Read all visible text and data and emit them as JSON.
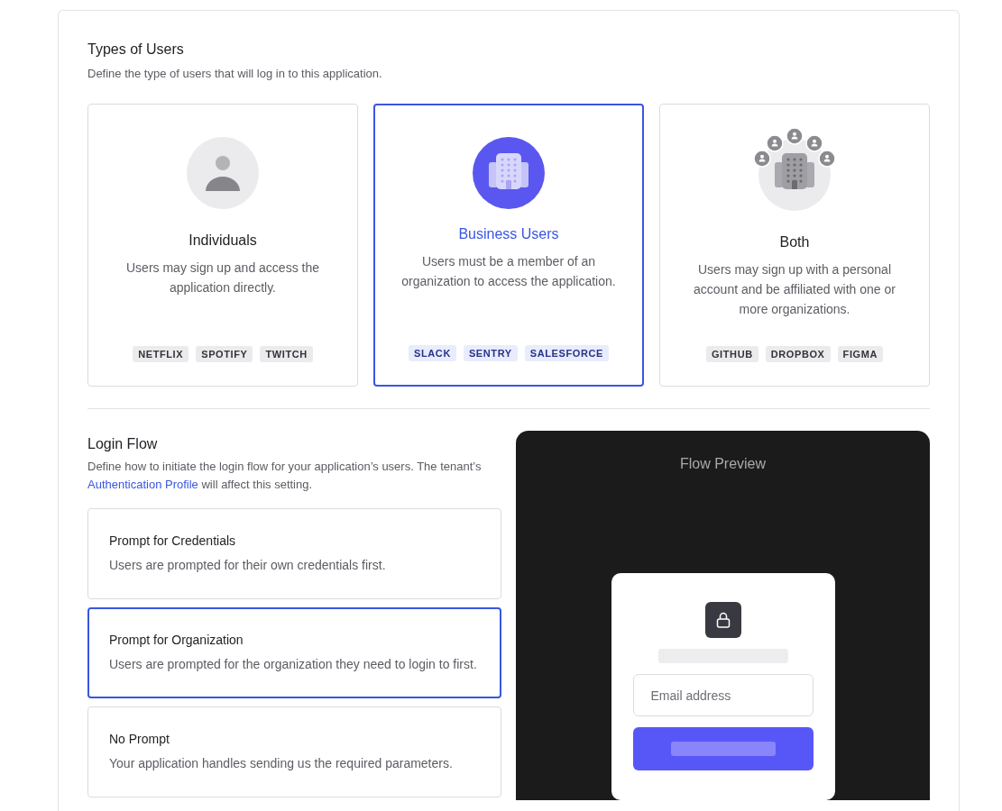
{
  "user_types": {
    "title": "Types of Users",
    "description": "Define the type of users that will log in to this application.",
    "cards": [
      {
        "kind": "individual",
        "title": "Individuals",
        "description": "Users may sign up and access the application directly.",
        "selected": false,
        "tags": [
          "NETFLIX",
          "SPOTIFY",
          "TWITCH"
        ]
      },
      {
        "kind": "business",
        "title": "Business Users",
        "description": "Users must be a member of an organization to access the application.",
        "selected": true,
        "tags": [
          "SLACK",
          "SENTRY",
          "SALESFORCE"
        ]
      },
      {
        "kind": "both",
        "title": "Both",
        "description": "Users may sign up with a personal account and be affiliated with one or more organizations.",
        "selected": false,
        "tags": [
          "GITHUB",
          "DROPBOX",
          "FIGMA"
        ]
      }
    ]
  },
  "login_flow": {
    "title": "Login Flow",
    "description_start": "Define how to initiate the login flow for your application’s users. The tenant’s ",
    "link": "Authentication Profile",
    "description_end": " will affect this setting.",
    "options": [
      {
        "title": "Prompt for Credentials",
        "description": "Users are prompted for their own credentials first.",
        "selected": false
      },
      {
        "title": "Prompt for Organization",
        "description": "Users are prompted for the organization they need to login to first.",
        "selected": true
      },
      {
        "title": "No Prompt",
        "description": "Your application handles sending us the required parameters.",
        "selected": false
      }
    ]
  },
  "preview": {
    "title": "Flow Preview",
    "email_placeholder": "Email address"
  }
}
